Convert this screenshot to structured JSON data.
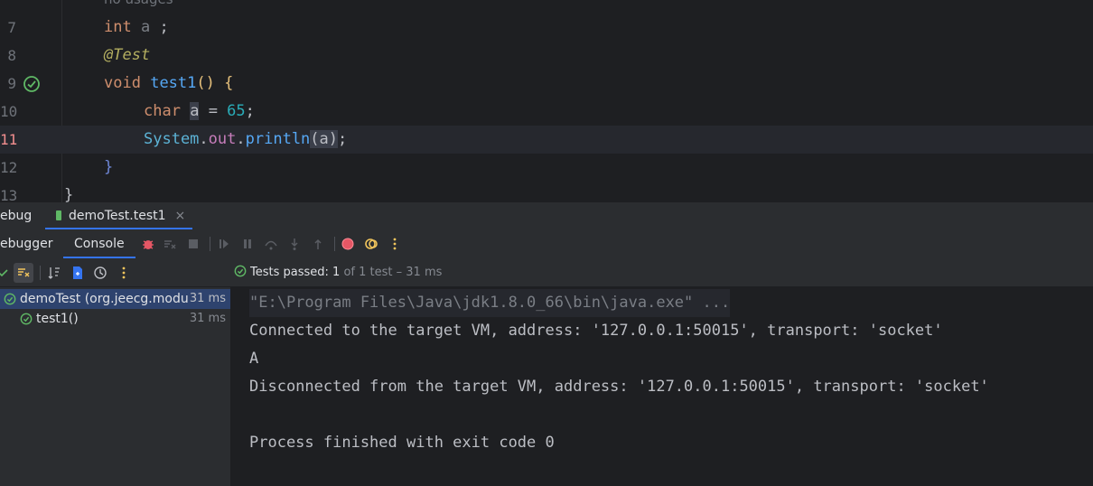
{
  "editor": {
    "hint_top": "no usages",
    "lines": [
      {
        "num": "7"
      },
      {
        "num": "8"
      },
      {
        "num": "9"
      },
      {
        "num": "10"
      },
      {
        "num": "11"
      },
      {
        "num": "12"
      },
      {
        "num": "13"
      }
    ],
    "l7": {
      "kw": "int",
      "var": "a",
      "rest": " ;"
    },
    "l8": {
      "ann": "@Test"
    },
    "l9": {
      "kw": "void",
      "fn": "test1",
      "parens": "()",
      "brace": " {"
    },
    "l10": {
      "kw": "char",
      "var": "a",
      "eq": " = ",
      "num": "65",
      "semi": ";"
    },
    "l11": {
      "cls": "System",
      "dot1": ".",
      "fld": "out",
      "dot2": ".",
      "fn": "println",
      "po": "(",
      "arg": "a",
      "pc": ")",
      "semi": ";"
    },
    "l12": {
      "brace": "}"
    },
    "l13": {
      "brace": "}"
    }
  },
  "tabs": {
    "debug_label": "ebug",
    "run_tab_label": "demoTest.test1",
    "close_glyph": "×"
  },
  "toolbar": {
    "debugger_label": "ebugger",
    "console_label": "Console"
  },
  "status": {
    "prefix": "Tests passed: ",
    "passed": "1",
    "of": " of 1 test",
    "dash": " – ",
    "time": "31 ms"
  },
  "tree": {
    "items": [
      {
        "label": "demoTest (org.jeecg.modu",
        "time": "31 ms"
      },
      {
        "label": "test1()",
        "time": "31 ms"
      }
    ]
  },
  "console": {
    "lines": [
      "\"E:\\Program Files\\Java\\jdk1.8.0_66\\bin\\java.exe\" ...",
      "Connected to the target VM, address: '127.0.0.1:50015', transport: 'socket'",
      "A",
      "Disconnected from the target VM, address: '127.0.0.1:50015', transport: 'socket'",
      "",
      "Process finished with exit code 0"
    ]
  },
  "colors": {
    "accent": "#3574f0",
    "pass_green": "#5fb865",
    "stop_red": "#e55765"
  }
}
